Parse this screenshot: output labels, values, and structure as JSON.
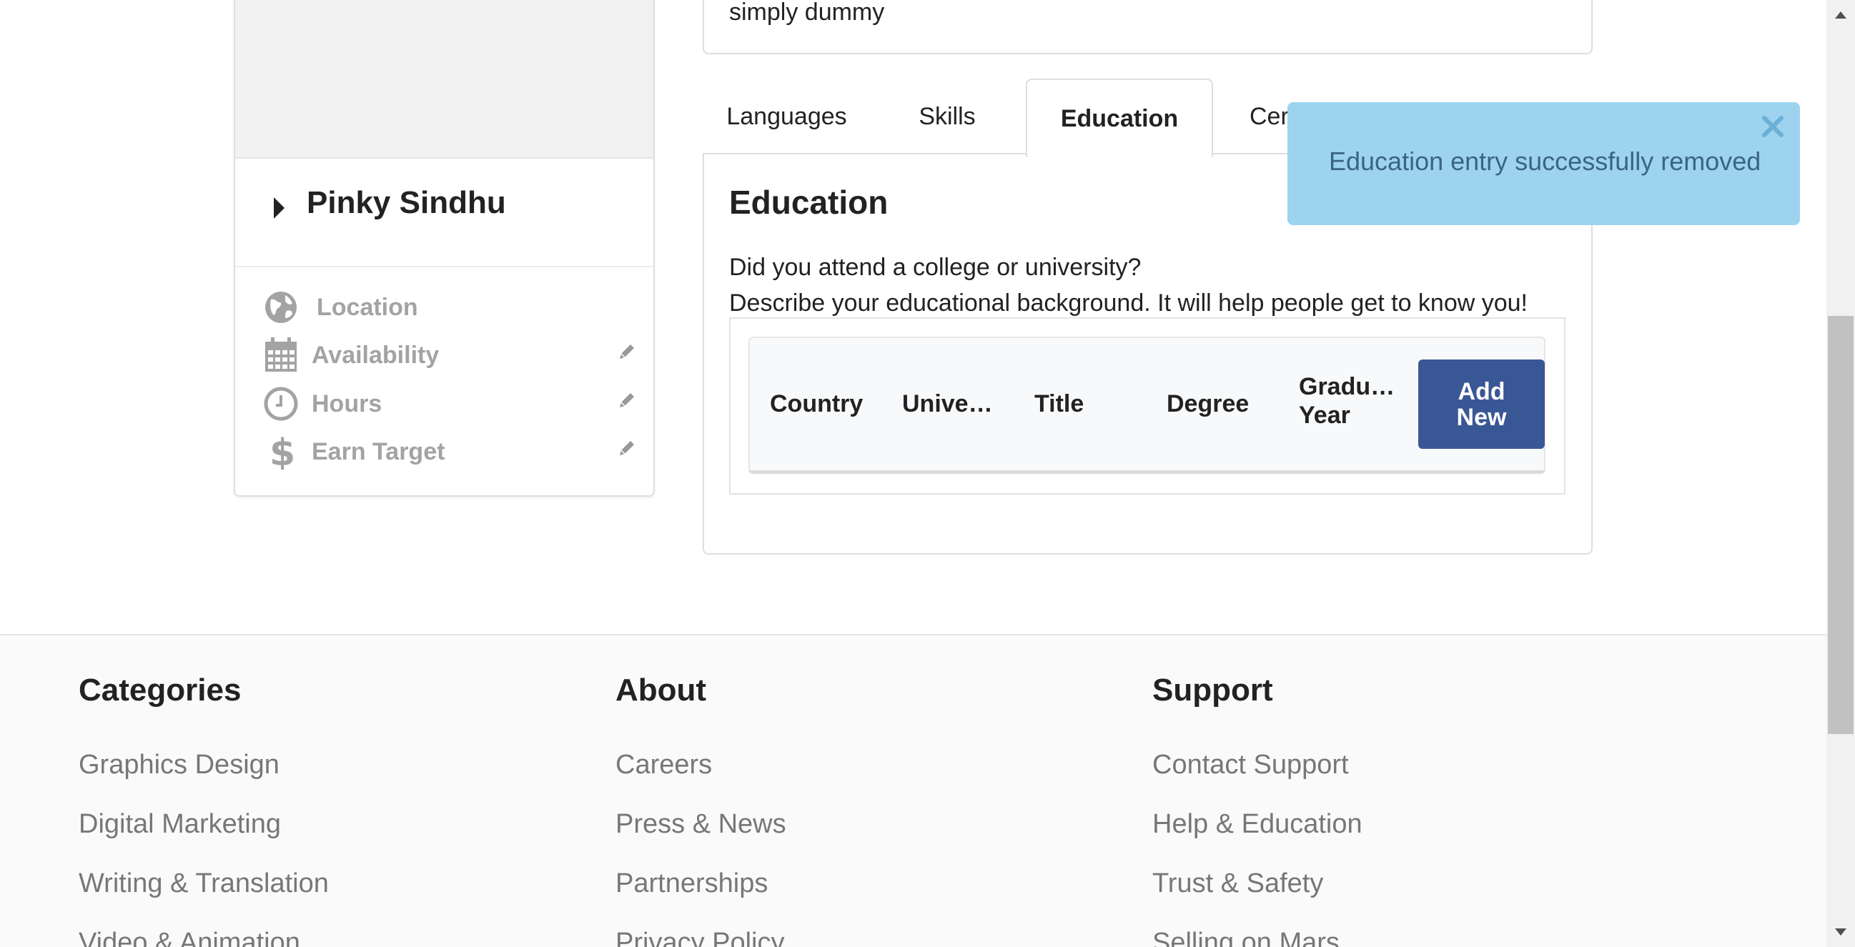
{
  "profile": {
    "name": "Pinky Sindhu",
    "meta": [
      {
        "label": "Location",
        "icon": "globe-icon",
        "editable": false
      },
      {
        "label": "Availability",
        "icon": "calendar-icon",
        "editable": true
      },
      {
        "label": "Hours",
        "icon": "clock-icon",
        "editable": true
      },
      {
        "label": "Earn Target",
        "icon": "dollar-icon",
        "editable": true
      }
    ]
  },
  "summary": {
    "text": "simply dummy"
  },
  "tabs": [
    {
      "label": "Languages",
      "active": false
    },
    {
      "label": "Skills",
      "active": false
    },
    {
      "label": "Education",
      "active": true
    },
    {
      "label": "Cer",
      "active": false
    }
  ],
  "education": {
    "title": "Education",
    "line1": "Did you attend a college or university?",
    "line2": "Describe your educational background. It will help people get to know you!",
    "columns": [
      "Country",
      "Unive…",
      "Title",
      "Degree",
      "Gradu…",
      "Year"
    ],
    "add_line1": "Add",
    "add_line2": "New"
  },
  "toast": {
    "message": "Education entry successfully removed",
    "color": "#9dd3ef"
  },
  "footer": {
    "categories": {
      "heading": "Categories",
      "links": [
        "Graphics Design",
        "Digital Marketing",
        "Writing & Translation",
        "Video & Animation"
      ]
    },
    "about": {
      "heading": "About",
      "links": [
        "Careers",
        "Press & News",
        "Partnerships",
        "Privacy Policy"
      ]
    },
    "support": {
      "heading": "Support",
      "links": [
        "Contact Support",
        "Help & Education",
        "Trust & Safety",
        "Selling on Mars"
      ]
    }
  },
  "colors": {
    "accent": "#3a5795",
    "muted": "#a3a3a3"
  }
}
